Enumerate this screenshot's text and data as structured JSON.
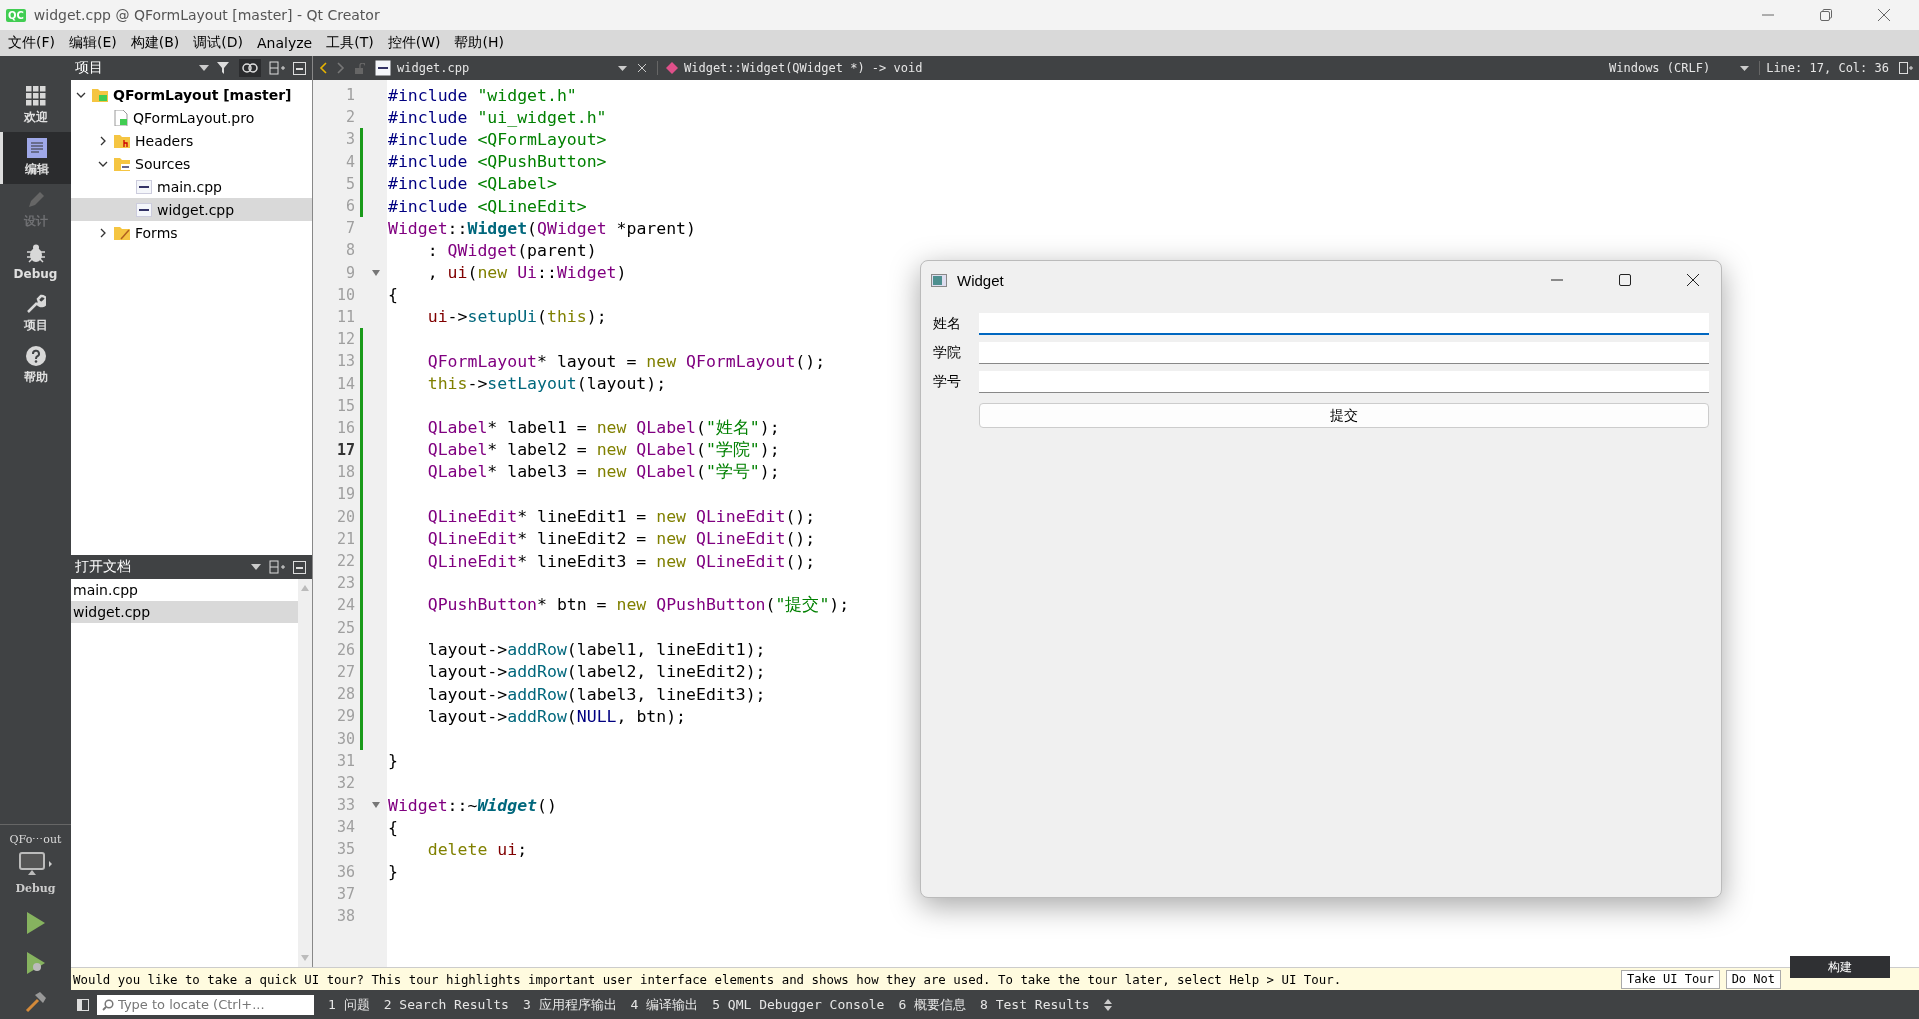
{
  "window": {
    "logo": "QC",
    "title": "widget.cpp @ QFormLayout [master] - Qt Creator"
  },
  "menu": [
    "文件(F)",
    "编辑(E)",
    "构建(B)",
    "调试(D)",
    "Analyze",
    "工具(T)",
    "控件(W)",
    "帮助(H)"
  ],
  "modes": [
    {
      "kind": "welcome",
      "label": "欢迎",
      "selected": false,
      "disabled": false
    },
    {
      "kind": "edit",
      "label": "编辑",
      "selected": true,
      "disabled": false
    },
    {
      "kind": "design",
      "label": "设计",
      "selected": false,
      "disabled": true
    },
    {
      "kind": "debug",
      "label": "Debug",
      "selected": false,
      "disabled": false
    },
    {
      "kind": "projects",
      "label": "项目",
      "selected": false,
      "disabled": false
    },
    {
      "kind": "help",
      "label": "帮助",
      "selected": false,
      "disabled": false
    }
  ],
  "target": {
    "project": "QFo⋯out",
    "config": "Debug"
  },
  "projects": {
    "title": "项目",
    "tree": [
      {
        "kind": "project",
        "label": "QFormLayout [master]",
        "selected": false,
        "expanded": true,
        "children": [
          {
            "kind": "profile",
            "label": "QFormLayout.pro",
            "selected": false
          },
          {
            "kind": "headers",
            "label": "Headers",
            "selected": false,
            "expanded": false
          },
          {
            "kind": "sources",
            "label": "Sources",
            "selected": false,
            "expanded": true,
            "children": [
              {
                "kind": "source",
                "label": "main.cpp",
                "selected": false
              },
              {
                "kind": "source",
                "label": "widget.cpp",
                "selected": true
              }
            ]
          },
          {
            "kind": "forms",
            "label": "Forms",
            "selected": false,
            "expanded": false
          }
        ]
      }
    ]
  },
  "open_documents": {
    "title": "打开文档",
    "items": [
      {
        "label": "main.cpp",
        "selected": false
      },
      {
        "label": "widget.cpp",
        "selected": true
      }
    ]
  },
  "editor_toolbar": {
    "file": "widget.cpp",
    "symbol": "Widget::Widget(QWidget *) -> void",
    "line_ending": "Windows (CRLF)",
    "position": "Line: 17, Col: 36"
  },
  "code": [
    {
      "number": "1",
      "changed": false,
      "fold": false,
      "current": false,
      "tokens": [
        {
          "kind": "pp",
          "text": "#include "
        },
        {
          "kind": "s",
          "text": "\"widget.h\""
        }
      ]
    },
    {
      "number": "2",
      "changed": false,
      "fold": false,
      "current": false,
      "tokens": [
        {
          "kind": "pp",
          "text": "#include "
        },
        {
          "kind": "s",
          "text": "\"ui_widget.h\""
        }
      ]
    },
    {
      "number": "3",
      "changed": true,
      "fold": false,
      "current": false,
      "tokens": [
        {
          "kind": "pp",
          "text": "#include "
        },
        {
          "kind": "s",
          "text": "<QFormLayout>"
        }
      ]
    },
    {
      "number": "4",
      "changed": true,
      "fold": false,
      "current": false,
      "tokens": [
        {
          "kind": "pp",
          "text": "#include "
        },
        {
          "kind": "s",
          "text": "<QPushButton>"
        }
      ]
    },
    {
      "number": "5",
      "changed": true,
      "fold": false,
      "current": false,
      "tokens": [
        {
          "kind": "pp",
          "text": "#include "
        },
        {
          "kind": "s",
          "text": "<QLabel>"
        }
      ]
    },
    {
      "number": "6",
      "changed": true,
      "fold": false,
      "current": false,
      "tokens": [
        {
          "kind": "pp",
          "text": "#include "
        },
        {
          "kind": "s",
          "text": "<QLineEdit>"
        }
      ]
    },
    {
      "number": "7",
      "changed": false,
      "fold": false,
      "current": false,
      "tokens": [
        {
          "kind": "t",
          "text": "Widget"
        },
        {
          "kind": "p",
          "text": "::"
        },
        {
          "kind": "fb",
          "text": "Widget"
        },
        {
          "kind": "p",
          "text": "("
        },
        {
          "kind": "t",
          "text": "QWidget"
        },
        {
          "kind": "p",
          "text": " *parent)"
        }
      ]
    },
    {
      "number": "8",
      "changed": false,
      "fold": false,
      "current": false,
      "tokens": [
        {
          "kind": "p",
          "text": "    : "
        },
        {
          "kind": "t",
          "text": "QWidget"
        },
        {
          "kind": "p",
          "text": "(parent)"
        }
      ]
    },
    {
      "number": "9",
      "changed": false,
      "fold": true,
      "current": false,
      "tokens": [
        {
          "kind": "p",
          "text": "    , "
        },
        {
          "kind": "m",
          "text": "ui"
        },
        {
          "kind": "p",
          "text": "("
        },
        {
          "kind": "k",
          "text": "new"
        },
        {
          "kind": "t",
          "text": " Ui"
        },
        {
          "kind": "p",
          "text": "::"
        },
        {
          "kind": "t",
          "text": "Widget"
        },
        {
          "kind": "p",
          "text": ")"
        }
      ]
    },
    {
      "number": "10",
      "changed": false,
      "fold": false,
      "current": false,
      "tokens": [
        {
          "kind": "p",
          "text": "{"
        }
      ]
    },
    {
      "number": "11",
      "changed": false,
      "fold": false,
      "current": false,
      "tokens": [
        {
          "kind": "m",
          "text": "    ui"
        },
        {
          "kind": "p",
          "text": "->"
        },
        {
          "kind": "f",
          "text": "setupUi"
        },
        {
          "kind": "p",
          "text": "("
        },
        {
          "kind": "k",
          "text": "this"
        },
        {
          "kind": "p",
          "text": ");"
        }
      ]
    },
    {
      "number": "12",
      "changed": true,
      "fold": false,
      "current": false
    },
    {
      "number": "13",
      "changed": true,
      "fold": false,
      "current": false,
      "tokens": [
        {
          "kind": "t",
          "text": "    QFormLayout"
        },
        {
          "kind": "p",
          "text": "* layout = "
        },
        {
          "kind": "k",
          "text": "new"
        },
        {
          "kind": "t",
          "text": " QFormLayout"
        },
        {
          "kind": "p",
          "text": "();"
        }
      ]
    },
    {
      "number": "14",
      "changed": true,
      "fold": false,
      "current": false,
      "tokens": [
        {
          "kind": "k",
          "text": "    this"
        },
        {
          "kind": "p",
          "text": "->"
        },
        {
          "kind": "f",
          "text": "setLayout"
        },
        {
          "kind": "p",
          "text": "(layout);"
        }
      ]
    },
    {
      "number": "15",
      "changed": true,
      "fold": false,
      "current": false
    },
    {
      "number": "16",
      "changed": true,
      "fold": false,
      "current": false,
      "tokens": [
        {
          "kind": "t",
          "text": "    QLabel"
        },
        {
          "kind": "p",
          "text": "* label1 = "
        },
        {
          "kind": "k",
          "text": "new"
        },
        {
          "kind": "t",
          "text": " QLabel"
        },
        {
          "kind": "p",
          "text": "("
        },
        {
          "kind": "s",
          "text": "\"姓名\""
        },
        {
          "kind": "p",
          "text": ");"
        }
      ]
    },
    {
      "number": "17",
      "changed": true,
      "fold": false,
      "current": true,
      "tokens": [
        {
          "kind": "t",
          "text": "    QLabel"
        },
        {
          "kind": "p",
          "text": "* label2 = "
        },
        {
          "kind": "k",
          "text": "new"
        },
        {
          "kind": "t",
          "text": " QLabel"
        },
        {
          "kind": "p",
          "text": "("
        },
        {
          "kind": "s",
          "text": "\"学院\""
        },
        {
          "kind": "p",
          "text": ");"
        }
      ]
    },
    {
      "number": "18",
      "changed": true,
      "fold": false,
      "current": false,
      "tokens": [
        {
          "kind": "t",
          "text": "    QLabel"
        },
        {
          "kind": "p",
          "text": "* label3 = "
        },
        {
          "kind": "k",
          "text": "new"
        },
        {
          "kind": "t",
          "text": " QLabel"
        },
        {
          "kind": "p",
          "text": "("
        },
        {
          "kind": "s",
          "text": "\"学号\""
        },
        {
          "kind": "p",
          "text": ");"
        }
      ]
    },
    {
      "number": "19",
      "changed": true,
      "fold": false,
      "current": false
    },
    {
      "number": "20",
      "changed": true,
      "fold": false,
      "current": false,
      "tokens": [
        {
          "kind": "t",
          "text": "    QLineEdit"
        },
        {
          "kind": "p",
          "text": "* lineEdit1 = "
        },
        {
          "kind": "k",
          "text": "new"
        },
        {
          "kind": "t",
          "text": " QLineEdit"
        },
        {
          "kind": "p",
          "text": "();"
        }
      ]
    },
    {
      "number": "21",
      "changed": true,
      "fold": false,
      "current": false,
      "tokens": [
        {
          "kind": "t",
          "text": "    QLineEdit"
        },
        {
          "kind": "p",
          "text": "* lineEdit2 = "
        },
        {
          "kind": "k",
          "text": "new"
        },
        {
          "kind": "t",
          "text": " QLineEdit"
        },
        {
          "kind": "p",
          "text": "();"
        }
      ]
    },
    {
      "number": "22",
      "changed": true,
      "fold": false,
      "current": false,
      "tokens": [
        {
          "kind": "t",
          "text": "    QLineEdit"
        },
        {
          "kind": "p",
          "text": "* lineEdit3 = "
        },
        {
          "kind": "k",
          "text": "new"
        },
        {
          "kind": "t",
          "text": " QLineEdit"
        },
        {
          "kind": "p",
          "text": "();"
        }
      ]
    },
    {
      "number": "23",
      "changed": true,
      "fold": false,
      "current": false
    },
    {
      "number": "24",
      "changed": true,
      "fold": false,
      "current": false,
      "tokens": [
        {
          "kind": "t",
          "text": "    QPushButton"
        },
        {
          "kind": "p",
          "text": "* btn = "
        },
        {
          "kind": "k",
          "text": "new"
        },
        {
          "kind": "t",
          "text": " QPushButton"
        },
        {
          "kind": "p",
          "text": "("
        },
        {
          "kind": "s",
          "text": "\"提交\""
        },
        {
          "kind": "p",
          "text": ");"
        }
      ]
    },
    {
      "number": "25",
      "changed": true,
      "fold": false,
      "current": false
    },
    {
      "number": "26",
      "changed": true,
      "fold": false,
      "current": false,
      "tokens": [
        {
          "kind": "p",
          "text": "    layout->"
        },
        {
          "kind": "f",
          "text": "addRow"
        },
        {
          "kind": "p",
          "text": "(label1, lineEdit1);"
        }
      ]
    },
    {
      "number": "27",
      "changed": true,
      "fold": false,
      "current": false,
      "tokens": [
        {
          "kind": "p",
          "text": "    layout->"
        },
        {
          "kind": "f",
          "text": "addRow"
        },
        {
          "kind": "p",
          "text": "(label2, lineEdit2);"
        }
      ]
    },
    {
      "number": "28",
      "changed": true,
      "fold": false,
      "current": false,
      "tokens": [
        {
          "kind": "p",
          "text": "    layout->"
        },
        {
          "kind": "f",
          "text": "addRow"
        },
        {
          "kind": "p",
          "text": "(label3, lineEdit3);"
        }
      ]
    },
    {
      "number": "29",
      "changed": true,
      "fold": false,
      "current": false,
      "tokens": [
        {
          "kind": "p",
          "text": "    layout->"
        },
        {
          "kind": "f",
          "text": "addRow"
        },
        {
          "kind": "p",
          "text": "("
        },
        {
          "kind": "pp",
          "text": "NULL"
        },
        {
          "kind": "p",
          "text": ", btn);"
        }
      ]
    },
    {
      "number": "30",
      "changed": true,
      "fold": false,
      "current": false
    },
    {
      "number": "31",
      "changed": false,
      "fold": false,
      "current": false,
      "tokens": [
        {
          "kind": "p",
          "text": "}"
        }
      ]
    },
    {
      "number": "32",
      "changed": false,
      "fold": false,
      "current": false
    },
    {
      "number": "33",
      "changed": false,
      "fold": true,
      "current": false,
      "tokens": [
        {
          "kind": "t",
          "text": "Widget"
        },
        {
          "kind": "p",
          "text": "::~"
        },
        {
          "kind": "fi",
          "text": "Widget"
        },
        {
          "kind": "p",
          "text": "()"
        }
      ]
    },
    {
      "number": "34",
      "changed": false,
      "fold": false,
      "current": false,
      "tokens": [
        {
          "kind": "p",
          "text": "{"
        }
      ]
    },
    {
      "number": "35",
      "changed": false,
      "fold": false,
      "current": false,
      "tokens": [
        {
          "kind": "k",
          "text": "    delete"
        },
        {
          "kind": "m",
          "text": " ui"
        },
        {
          "kind": "p",
          "text": ";"
        }
      ]
    },
    {
      "number": "36",
      "changed": false,
      "fold": false,
      "current": false,
      "tokens": [
        {
          "kind": "p",
          "text": "}"
        }
      ]
    },
    {
      "number": "37",
      "changed": false,
      "fold": false,
      "current": false
    },
    {
      "number": "38",
      "changed": false,
      "fold": false,
      "current": false
    }
  ],
  "app_window": {
    "title": "Widget",
    "rows": [
      {
        "label": "姓名",
        "focused": true
      },
      {
        "label": "学院",
        "focused": false
      },
      {
        "label": "学号",
        "focused": false
      }
    ],
    "button": "提交"
  },
  "tour_bar": {
    "message": "Would you like to take a quick UI tour? This tour highlights important user interface elements and shows how they are used. To take the tour later, select Help > UI Tour.",
    "buttons": [
      "Take UI Tour",
      "Do Not"
    ]
  },
  "build_tooltip": "构建",
  "status_bar": {
    "locator_placeholder": "Type to locate (Ctrl+...",
    "panes": [
      "1 问题",
      "2 Search Results",
      "3 应用程序输出",
      "4 编译输出",
      "5 QML Debugger Console",
      "6 概要信息",
      "8 Test Results"
    ]
  }
}
